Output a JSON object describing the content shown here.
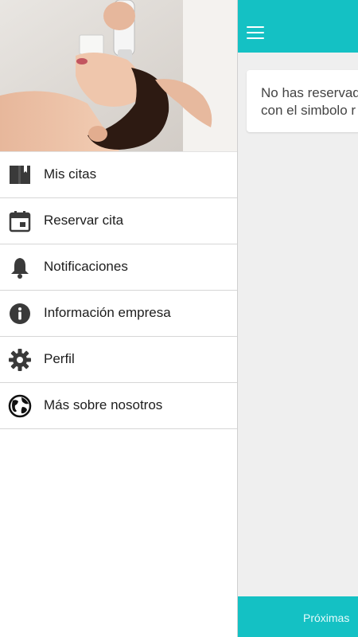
{
  "main": {
    "message_line1": "No has reservad",
    "message_line2": "con el simbolo r",
    "bottom_tab_label": "Próximas",
    "accent_color": "#14c1c4"
  },
  "drawer": {
    "menu": [
      {
        "label": "Mis citas",
        "icon": "book-icon"
      },
      {
        "label": "Reservar cita",
        "icon": "calendar-icon"
      },
      {
        "label": "Notificaciones",
        "icon": "bell-icon"
      },
      {
        "label": "Información empresa",
        "icon": "info-icon"
      },
      {
        "label": "Perfil",
        "icon": "gear-icon"
      },
      {
        "label": "Más sobre nosotros",
        "icon": "globe-icon"
      }
    ]
  }
}
